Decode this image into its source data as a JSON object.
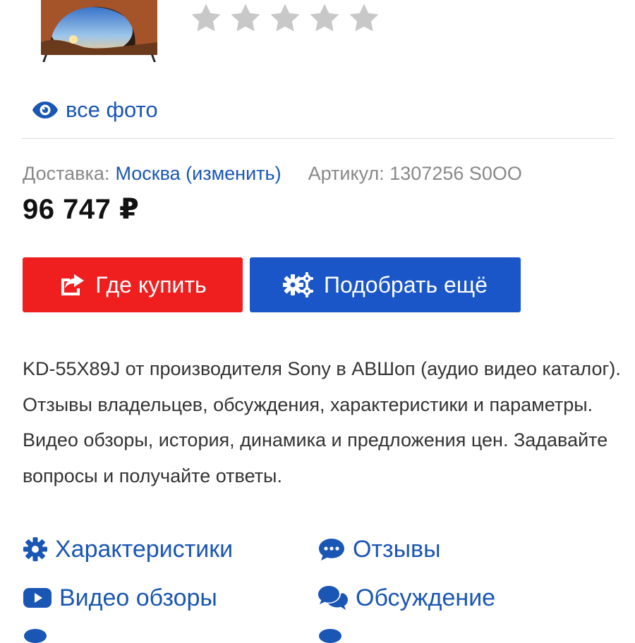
{
  "product": {
    "image_icon": "tv-thumbnail",
    "rating_stars": 0,
    "rating_max": 5
  },
  "gallery": {
    "all_photos_label": "все фото",
    "icon": "eye-icon"
  },
  "delivery": {
    "label": "Доставка:",
    "city_label": "Москва (изменить)",
    "sku_label": "Артикул: 1307256 S0OO"
  },
  "price": "96 747 ₽",
  "actions": {
    "buy_label": "Где купить",
    "buy_icon": "share-icon",
    "buy_color": "#f01f1f",
    "more_label": "Подобрать ещё",
    "more_icon": "gears-icon",
    "more_color": "#1a56c8"
  },
  "description": "KD-55X89J от производителя Sony в АВШоп (аудио видео каталог). Отзывы владельцев, обсуждения, характеристики и параметры. Видео обзоры, история, динамика и предложения цен. Задавайте вопросы и получайте ответы.",
  "links": [
    {
      "label": "Характеристики",
      "icon": "gear-icon"
    },
    {
      "label": "Отзывы",
      "icon": "comment-icon"
    },
    {
      "label": "Видео обзоры",
      "icon": "youtube-icon"
    },
    {
      "label": "Обсуждение",
      "icon": "comments-icon"
    }
  ],
  "colors": {
    "link": "#1a56b4",
    "muted": "#888888",
    "star_empty": "#c8c8c8"
  }
}
